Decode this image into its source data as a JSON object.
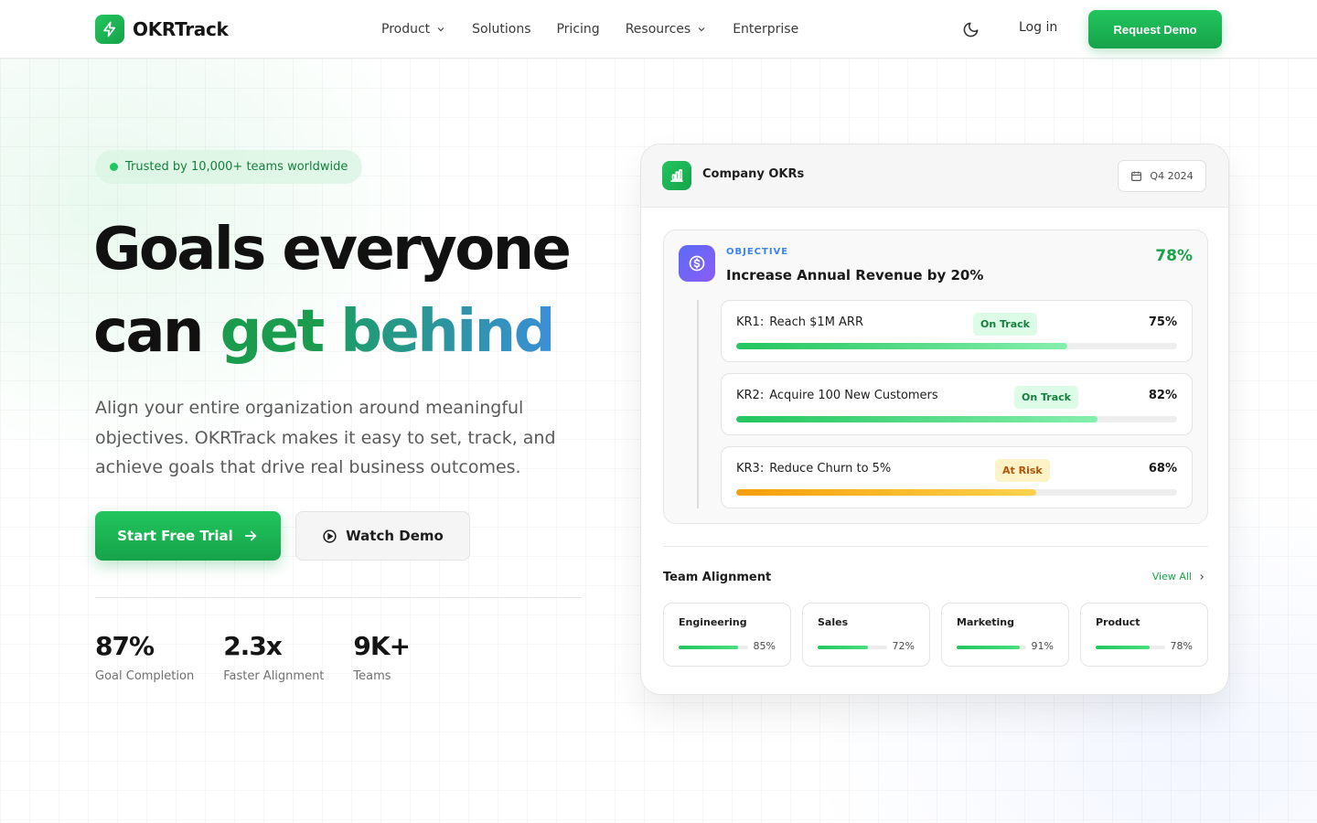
{
  "nav": {
    "brand": "OKRTrack",
    "items": [
      {
        "label": "Product",
        "dropdown": true
      },
      {
        "label": "Solutions",
        "dropdown": false
      },
      {
        "label": "Pricing",
        "dropdown": false
      },
      {
        "label": "Resources",
        "dropdown": true
      },
      {
        "label": "Enterprise",
        "dropdown": false
      }
    ],
    "login": "Log in",
    "cta": "Request Demo"
  },
  "hero": {
    "badge": "Trusted by 10,000+ teams worldwide",
    "headline_line1": "Goals everyone",
    "headline_can": "can",
    "headline_get": "get",
    "headline_behind": "behind",
    "subtitle": "Align your entire organization around meaningful objectives. OKRTrack makes it easy to set, track, and achieve goals that drive real business outcomes.",
    "primary_cta": "Start Free Trial",
    "secondary_cta": "Watch Demo",
    "stats": [
      {
        "value": "87%",
        "label": "Goal Completion"
      },
      {
        "value": "2.3x",
        "label": "Faster Alignment"
      },
      {
        "value": "9K+",
        "label": "Teams"
      }
    ]
  },
  "card": {
    "title": "Company OKRs",
    "quarter": "Q4 2024",
    "objective": {
      "tag": "OBJECTIVE",
      "title": "Increase Annual Revenue by 20%",
      "progress": "78%"
    },
    "key_results": [
      {
        "code": "KR1:",
        "title": "Reach $1M ARR",
        "status": "On Track",
        "status_type": "on",
        "progress_label": "75%",
        "progress": 75
      },
      {
        "code": "KR2:",
        "title": "Acquire 100 New Customers",
        "status": "On Track",
        "status_type": "on",
        "progress_label": "82%",
        "progress": 82
      },
      {
        "code": "KR3:",
        "title": "Reduce Churn to 5%",
        "status": "At Risk",
        "status_type": "risk",
        "progress_label": "68%",
        "progress": 68
      }
    ],
    "alignment": {
      "title": "Team Alignment",
      "view_all": "View All",
      "teams": [
        {
          "name": "Engineering",
          "progress_label": "85%",
          "progress": 85
        },
        {
          "name": "Sales",
          "progress_label": "72%",
          "progress": 72
        },
        {
          "name": "Marketing",
          "progress_label": "91%",
          "progress": 91
        },
        {
          "name": "Product",
          "progress_label": "78%",
          "progress": 78
        }
      ]
    }
  },
  "colors": {
    "brand_green": "#16a34a",
    "accent_blue": "#3b82f6",
    "risk_amber": "#f59e0b"
  },
  "icons": {
    "brand": "bolt-icon",
    "theme": "moon-icon",
    "cta_arrow": "arrow-right-icon",
    "play": "play-circle-icon",
    "card": "bar-chart-icon",
    "calendar": "calendar-icon",
    "objective": "dollar-circle-icon",
    "view_all": "chevron-right-icon"
  }
}
